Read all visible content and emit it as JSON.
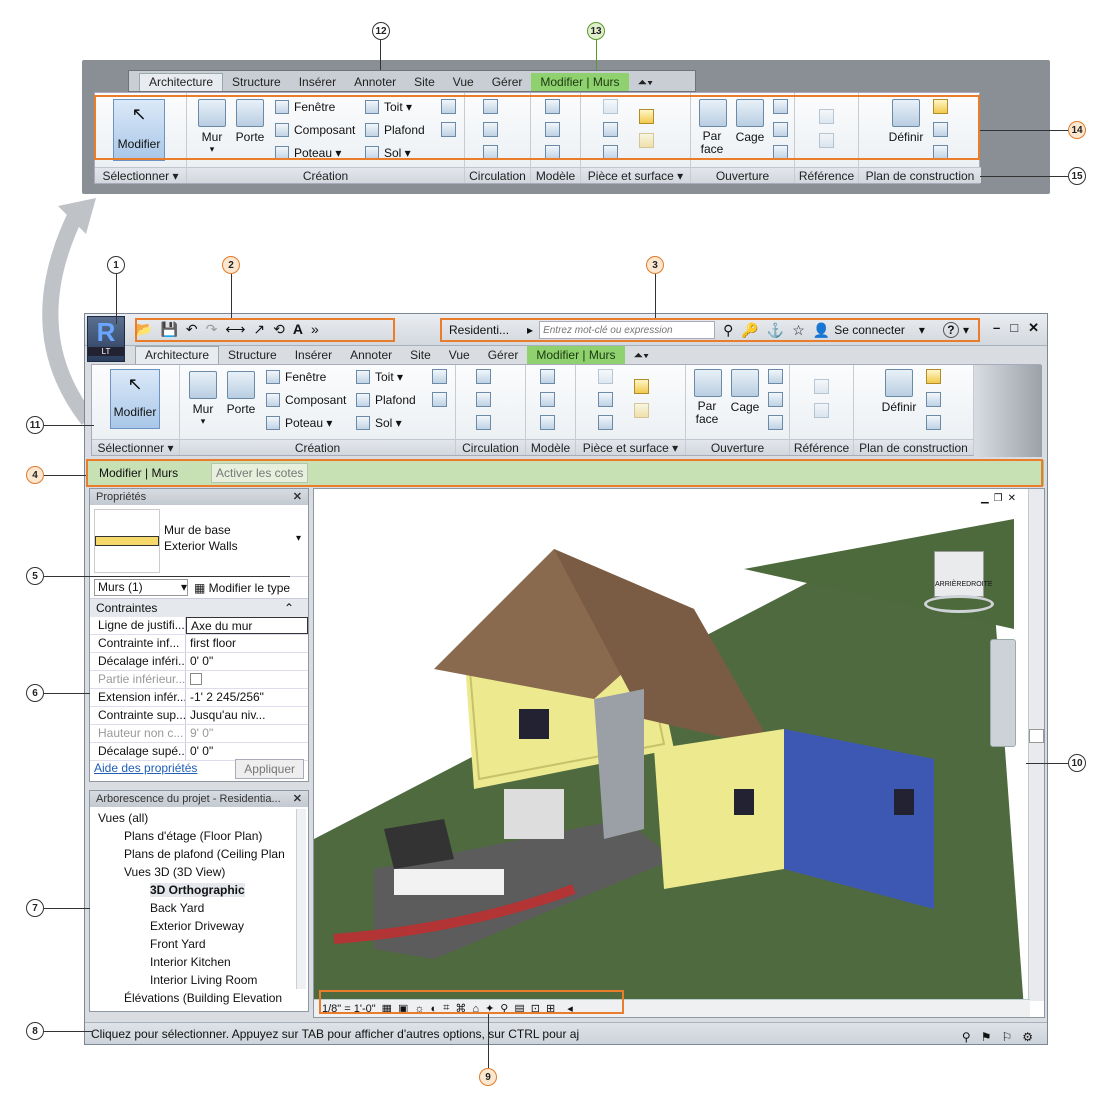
{
  "ribbon": {
    "tabs": [
      "Architecture",
      "Structure",
      "Insérer",
      "Annoter",
      "Site",
      "Vue",
      "Gérer"
    ],
    "context_tab": "Modifier | Murs",
    "modify_label": "Modifier",
    "select_label": "Sélectionner",
    "wall_label": "Mur",
    "door_label": "Porte",
    "window_label": "Fenêtre",
    "component_label": "Composant",
    "column_label": "Poteau",
    "roof_label": "Toit",
    "ceiling_label": "Plafond",
    "floor_label": "Sol",
    "by_face_label": "Par face",
    "shaft_label": "Cage",
    "set_label": "Définir",
    "panels": {
      "select": "Sélectionner",
      "build": "Création",
      "circulation": "Circulation",
      "model": "Modèle",
      "room_area": "Pièce et surface",
      "opening": "Ouverture",
      "datum": "Référence",
      "work_plane": "Plan de construction"
    }
  },
  "titlebar": {
    "project_short": "Residenti...",
    "search_placeholder": "Entrez mot-clé ou expression",
    "sign_in": "Se connecter",
    "logo_badge": "LT"
  },
  "options_bar": {
    "context": "Modifier | Murs",
    "activate_dims": "Activer les cotes"
  },
  "properties": {
    "title": "Propriétés",
    "type_family": "Mur de base",
    "type_name": "Exterior Walls",
    "filter": "Murs (1)",
    "edit_type": "Modifier le type",
    "group": "Contraintes",
    "rows": [
      {
        "k": "Ligne de justifi...",
        "v": "Axe du mur",
        "gray": false
      },
      {
        "k": "Contrainte inf...",
        "v": "first floor",
        "gray": false
      },
      {
        "k": "Décalage inféri...",
        "v": "0'  0\"",
        "gray": false
      },
      {
        "k": "Partie inférieur...",
        "v": "",
        "gray": true
      },
      {
        "k": "Extension infér...",
        "v": "-1'  2 245/256\"",
        "gray": false
      },
      {
        "k": "Contrainte sup...",
        "v": "Jusqu'au niv...",
        "gray": false
      },
      {
        "k": "Hauteur non c...",
        "v": "9'  0\"",
        "gray": true
      },
      {
        "k": "Décalage supé...",
        "v": "0'  0\"",
        "gray": false
      }
    ],
    "help": "Aide des propriétés",
    "apply": "Appliquer"
  },
  "browser": {
    "title": "Arborescence du projet - Residentia...",
    "items": [
      {
        "label": "Vues (all)",
        "level": 0,
        "bold": false
      },
      {
        "label": "Plans d'étage (Floor Plan)",
        "level": 1,
        "bold": false
      },
      {
        "label": "Plans de plafond (Ceiling Plan",
        "level": 1,
        "bold": false
      },
      {
        "label": "Vues 3D (3D View)",
        "level": 1,
        "bold": false
      },
      {
        "label": "3D Orthographic",
        "level": 2,
        "bold": true
      },
      {
        "label": "Back Yard",
        "level": 2,
        "bold": false
      },
      {
        "label": "Exterior Driveway",
        "level": 2,
        "bold": false
      },
      {
        "label": "Front Yard",
        "level": 2,
        "bold": false
      },
      {
        "label": "Interior Kitchen",
        "level": 2,
        "bold": false
      },
      {
        "label": "Interior Living Room",
        "level": 2,
        "bold": false
      },
      {
        "label": "Élévations (Building Elevation",
        "level": 1,
        "bold": false
      }
    ]
  },
  "view": {
    "scale": "1/8\" = 1'-0\"",
    "viewcube_left": "ARRIÈRE",
    "viewcube_right": "DROITE"
  },
  "status": {
    "text": "Cliquez pour sélectionner. Appuyez sur TAB pour afficher d'autres options, sur CTRL pour aj"
  },
  "callouts": [
    "1",
    "2",
    "3",
    "4",
    "5",
    "6",
    "7",
    "8",
    "9",
    "10",
    "11",
    "12",
    "13",
    "14",
    "15"
  ],
  "colors": {
    "highlight_orange": "#ea7d2b",
    "context_green": "#8fd06f",
    "selected_blue": "#3a55c8",
    "wall_yellow": "#ece98f"
  }
}
